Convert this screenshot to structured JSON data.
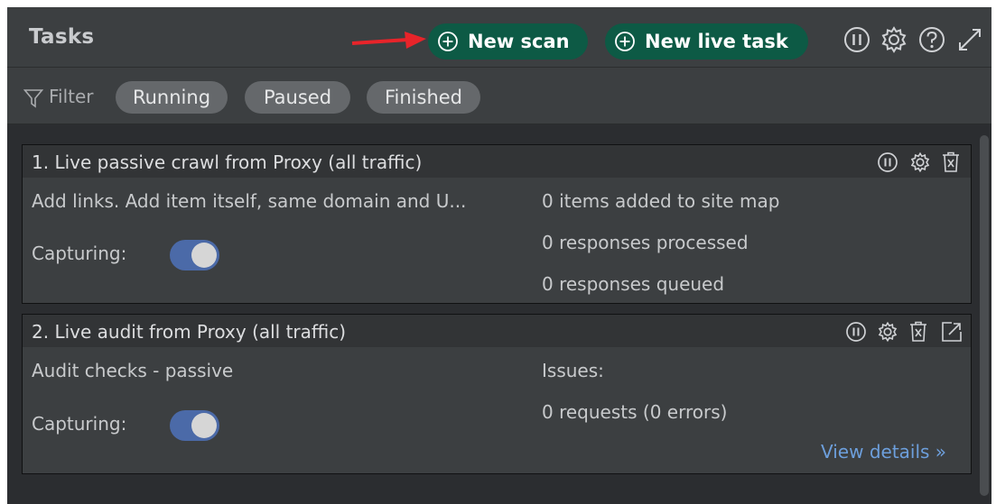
{
  "header": {
    "title": "Tasks",
    "new_scan_label": "New scan",
    "new_live_task_label": "New live task"
  },
  "filter": {
    "label": "Filter",
    "chips": [
      "Running",
      "Paused",
      "Finished"
    ]
  },
  "tasks": [
    {
      "title": "1. Live passive crawl from Proxy (all traffic)",
      "description": "Add links. Add item itself, same domain and U...",
      "capturing_label": "Capturing:",
      "capturing_on": true,
      "stats": [
        "0 items added to site map",
        "0 responses processed",
        "0 responses queued"
      ]
    },
    {
      "title": "2. Live audit from Proxy (all traffic)",
      "description": "Audit checks - passive",
      "capturing_label": "Capturing:",
      "capturing_on": true,
      "stats": [
        "Issues:",
        "0 requests (0 errors)"
      ],
      "view_details": "View details »"
    }
  ],
  "colors": {
    "accent_button": "#0d5a45",
    "toggle_on": "#4b6aa8",
    "link": "#6d9fdc",
    "arrow": "#e8242a"
  }
}
